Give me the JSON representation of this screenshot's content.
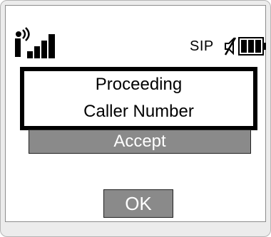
{
  "status_bar": {
    "network_label": "SIP",
    "icons": [
      "signal-strength-icon",
      "mute-icon",
      "battery-icon"
    ]
  },
  "dialog": {
    "line1": "Proceeding",
    "line2": "Caller Number"
  },
  "actions": {
    "accept_label": "Accept",
    "ok_label": "OK"
  },
  "colors": {
    "button_bg": "#8a8a8a",
    "dialog_border": "#000000",
    "screen_bg": "#ffffff"
  }
}
